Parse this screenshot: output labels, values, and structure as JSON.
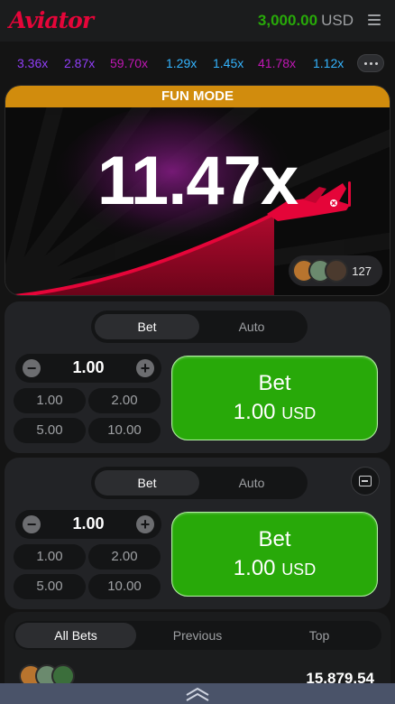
{
  "header": {
    "logo": "Aviator",
    "balance": "3,000.00",
    "currency": "USD",
    "menu_icon": "hamburger-menu-icon"
  },
  "history": [
    {
      "value": "3.36x",
      "color": "#913ef8"
    },
    {
      "value": "2.87x",
      "color": "#913ef8"
    },
    {
      "value": "59.70x",
      "color": "#c017b4"
    },
    {
      "value": "1.29x",
      "color": "#34b4ff"
    },
    {
      "value": "1.45x",
      "color": "#34b4ff"
    },
    {
      "value": "41.78x",
      "color": "#c017b4"
    },
    {
      "value": "1.12x",
      "color": "#34b4ff"
    }
  ],
  "game": {
    "mode_banner": "FUN MODE",
    "multiplier": "11.47x",
    "players_count": "127",
    "plane_icon": "airplane-icon"
  },
  "panels": [
    {
      "tabs": [
        "Bet",
        "Auto"
      ],
      "active_tab": "Bet",
      "amount": "1.00",
      "quick": [
        "1.00",
        "2.00",
        "5.00",
        "10.00"
      ],
      "bet_label": "Bet",
      "bet_amount": "1.00",
      "bet_currency": "USD"
    },
    {
      "tabs": [
        "Bet",
        "Auto"
      ],
      "active_tab": "Bet",
      "amount": "1.00",
      "quick": [
        "1.00",
        "2.00",
        "5.00",
        "10.00"
      ],
      "bet_label": "Bet",
      "bet_amount": "1.00",
      "bet_currency": "USD"
    }
  ],
  "bets": {
    "tabs": [
      "All Bets",
      "Previous",
      "Top"
    ],
    "active_tab": "All Bets",
    "total": "15,879.54"
  },
  "colors": {
    "brand_red": "#e50539",
    "balance_green": "#28a909",
    "bet_green": "#28a909",
    "fun_mode": "#d18c0d"
  }
}
